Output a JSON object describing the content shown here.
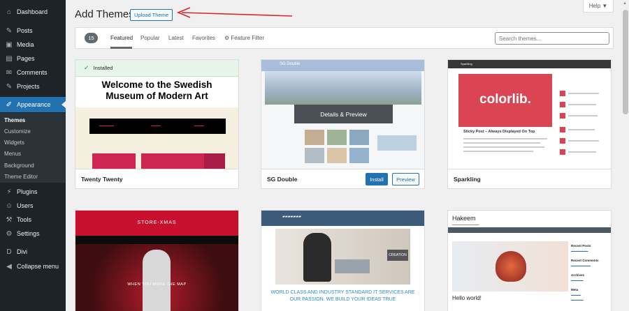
{
  "sidebar": {
    "items": [
      {
        "label": "Dashboard",
        "icon": "dashboard-icon",
        "glyph": "⌂"
      },
      {
        "label": "Posts",
        "icon": "pin-icon",
        "glyph": "✎"
      },
      {
        "label": "Media",
        "icon": "media-icon",
        "glyph": "▣"
      },
      {
        "label": "Pages",
        "icon": "pages-icon",
        "glyph": "▤"
      },
      {
        "label": "Comments",
        "icon": "comments-icon",
        "glyph": "✉"
      },
      {
        "label": "Projects",
        "icon": "pin-icon",
        "glyph": "✎"
      },
      {
        "label": "Appearance",
        "icon": "brush-icon",
        "glyph": "✐"
      },
      {
        "label": "Plugins",
        "icon": "plugin-icon",
        "glyph": "⚡"
      },
      {
        "label": "Users",
        "icon": "users-icon",
        "glyph": "☺"
      },
      {
        "label": "Tools",
        "icon": "wrench-icon",
        "glyph": "⚒"
      },
      {
        "label": "Settings",
        "icon": "settings-icon",
        "glyph": "⚙"
      },
      {
        "label": "Divi",
        "icon": "divi-icon",
        "glyph": "D"
      },
      {
        "label": "Collapse menu",
        "icon": "collapse-icon",
        "glyph": "◀"
      }
    ],
    "submenu": [
      "Themes",
      "Customize",
      "Widgets",
      "Menus",
      "Background",
      "Theme Editor"
    ]
  },
  "header": {
    "title": "Add Themes",
    "upload_label": "Upload Theme",
    "help_label": "Help ▼"
  },
  "filter": {
    "count": "15",
    "tabs": [
      "Featured",
      "Popular",
      "Latest",
      "Favorites"
    ],
    "feature_filter": "Feature Filter",
    "search_placeholder": "Search themes..."
  },
  "themes": {
    "twenty": {
      "name": "Twenty Twenty",
      "installed": "Installed",
      "headline1": "Welcome to the Swedish",
      "headline2": "Museum of Modern Art"
    },
    "sgdouble": {
      "name": "SG Double",
      "logo": "SG Double",
      "details": "Details & Preview",
      "install": "Install",
      "preview": "Preview"
    },
    "sparkling": {
      "name": "Sparkling",
      "brand": "Sparkling",
      "hero_text": "colorlib.",
      "sticky": "Sticky Post – Always Displayed On Top"
    },
    "xmas": {
      "logo": "STORE-XMAS",
      "tagline": "WHEN YOU MOVE THE MAP"
    },
    "business": {
      "badge": "CREATION",
      "headline1": "WORLD CLASS AND INDUSTRY STANDARD IT SERVICES ARE",
      "headline2": "OUR PASSION. WE BUILD YOUR IDEAS TRUE"
    },
    "hakeem": {
      "title": "Hakeem",
      "hello": "Hello world!",
      "side": [
        "Recent Posts",
        "Recent Comments",
        "Archives",
        "Meta"
      ]
    }
  },
  "colors": {
    "accent": "#2271b1",
    "sidebar": "#1d2327",
    "annotation_arrow": "#d9262d"
  }
}
